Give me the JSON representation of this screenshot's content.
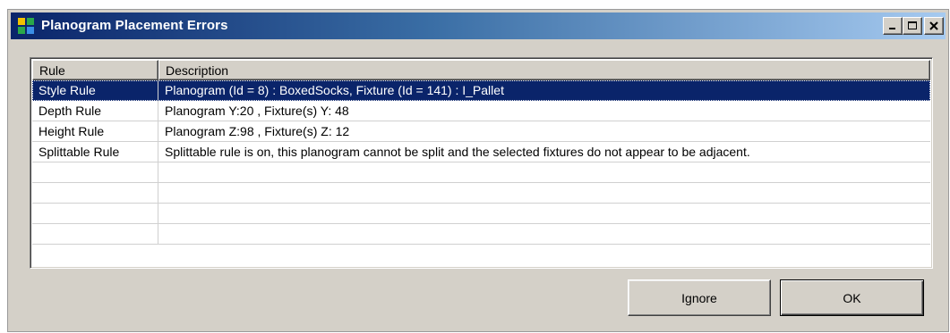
{
  "window": {
    "title": "Planogram Placement Errors",
    "icon": "grid-app-icon",
    "controls": [
      "minimize-icon",
      "maximize-icon",
      "close-icon"
    ]
  },
  "list": {
    "columns": [
      "Rule",
      "Description"
    ],
    "rows": [
      {
        "rule": "Style Rule",
        "description": "Planogram (Id = 8) : BoxedSocks, Fixture (Id = 141) : I_Pallet",
        "selected": true
      },
      {
        "rule": "Depth Rule",
        "description": "Planogram Y:20 , Fixture(s) Y: 48",
        "selected": false
      },
      {
        "rule": "Height Rule",
        "description": "Planogram Z:98 , Fixture(s) Z: 12",
        "selected": false
      },
      {
        "rule": "Splittable Rule",
        "description": "Splittable rule is on, this planogram cannot be split and the selected fixtures do not appear to be adjacent.",
        "selected": false
      },
      {
        "rule": "",
        "description": "",
        "selected": false
      },
      {
        "rule": "",
        "description": "",
        "selected": false
      },
      {
        "rule": "",
        "description": "",
        "selected": false
      },
      {
        "rule": "",
        "description": "",
        "selected": false
      }
    ]
  },
  "buttons": {
    "ignore": "Ignore",
    "ok": "OK"
  },
  "colors": {
    "titlebar_start": "#0a246a",
    "titlebar_end": "#a6caf0",
    "selection": "#0a246a",
    "face": "#d4d0c8"
  }
}
